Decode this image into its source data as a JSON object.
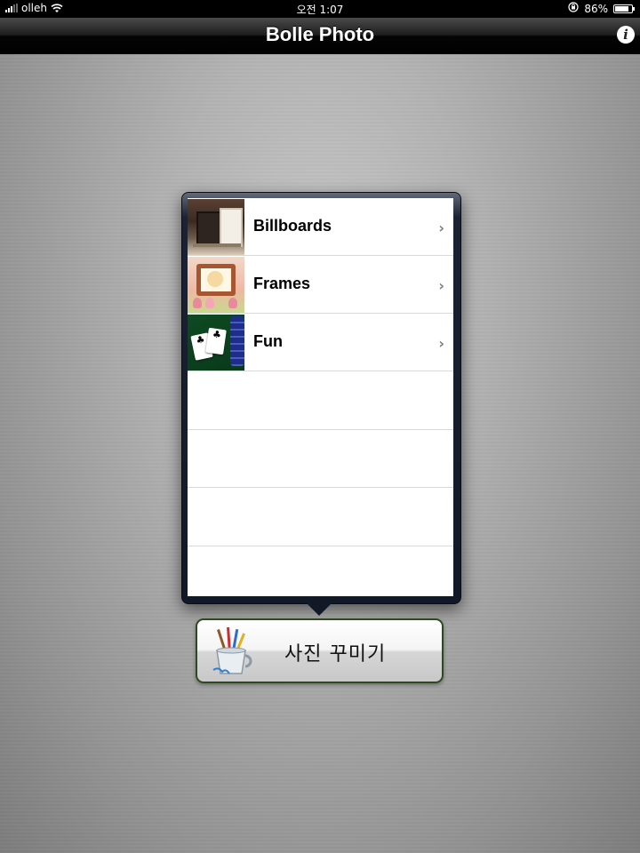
{
  "status_bar": {
    "carrier": "olleh",
    "time": "오전 1:07",
    "battery": "86%",
    "battery_level": 0.86,
    "icons": [
      "signal-bars-icon",
      "wifi-icon",
      "orientation-lock-icon",
      "battery-icon"
    ]
  },
  "nav_bar": {
    "title": "Bolle Photo",
    "info_label": "i"
  },
  "menu": {
    "items": [
      {
        "label": "Billboards",
        "chevron": "›",
        "thumbnail": "billboards-thumbnail"
      },
      {
        "label": "Frames",
        "chevron": "›",
        "thumbnail": "frames-thumbnail"
      },
      {
        "label": "Fun",
        "chevron": "›",
        "thumbnail": "fun-thumbnail"
      }
    ],
    "empty_rows": 4
  },
  "decorate_button": {
    "label": "사진 꾸미기",
    "icon": "brush-cup-icon",
    "border_color": "#2d4a1e"
  }
}
